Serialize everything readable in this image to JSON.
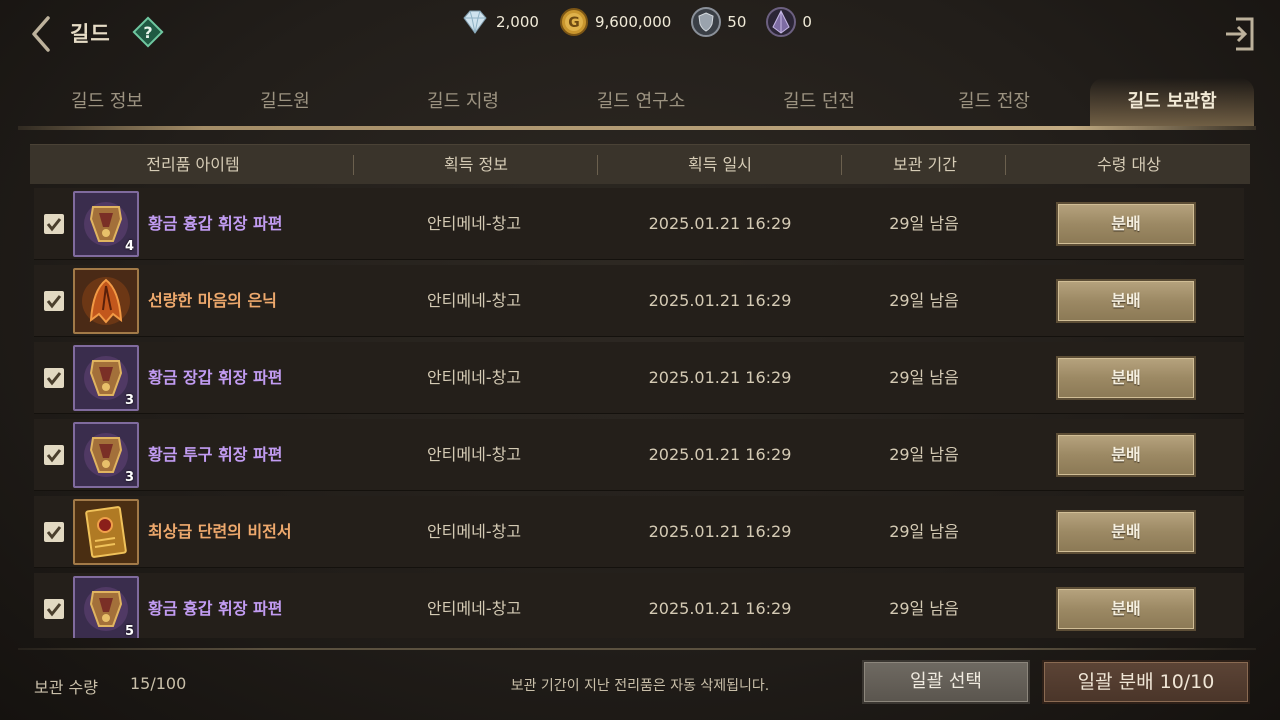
{
  "header": {
    "title": "길드",
    "currencies": [
      {
        "icon": "diamond-icon",
        "value": "2,000"
      },
      {
        "icon": "gold-coin-icon",
        "value": "9,600,000"
      },
      {
        "icon": "shield-token-icon",
        "value": "50"
      },
      {
        "icon": "crystal-icon",
        "value": "0"
      }
    ]
  },
  "tabs": [
    {
      "label": "길드 정보",
      "active": false
    },
    {
      "label": "길드원",
      "active": false
    },
    {
      "label": "길드 지령",
      "active": false
    },
    {
      "label": "길드 연구소",
      "active": false
    },
    {
      "label": "길드 던전",
      "active": false
    },
    {
      "label": "길드 전장",
      "active": false
    },
    {
      "label": "길드 보관함",
      "active": true
    }
  ],
  "table": {
    "columns": [
      "전리품 아이템",
      "획득 정보",
      "획득 일시",
      "보관 기간",
      "수령 대상"
    ],
    "rows": [
      {
        "checked": true,
        "item": "황금 흉갑 휘장 파편",
        "grade": "purple",
        "qty": "4",
        "source": "안티메네-창고",
        "date": "2025.01.21  16:29",
        "remaining": "29일 남음",
        "action": "분배"
      },
      {
        "checked": true,
        "item": "선량한 마음의 은닉",
        "grade": "orange",
        "qty": "",
        "source": "안티메네-창고",
        "date": "2025.01.21  16:29",
        "remaining": "29일 남음",
        "action": "분배"
      },
      {
        "checked": true,
        "item": "황금 장갑 휘장 파편",
        "grade": "purple",
        "qty": "3",
        "source": "안티메네-창고",
        "date": "2025.01.21  16:29",
        "remaining": "29일 남음",
        "action": "분배"
      },
      {
        "checked": true,
        "item": "황금 투구 휘장 파편",
        "grade": "purple",
        "qty": "3",
        "source": "안티메네-창고",
        "date": "2025.01.21  16:29",
        "remaining": "29일 남음",
        "action": "분배"
      },
      {
        "checked": true,
        "item": "최상급 단련의 비전서",
        "grade": "orange",
        "qty": "",
        "source": "안티메네-창고",
        "date": "2025.01.21  16:29",
        "remaining": "29일 남음",
        "action": "분배"
      },
      {
        "checked": true,
        "item": "황금 흉갑 휘장 파편",
        "grade": "purple",
        "qty": "5",
        "source": "안티메네-창고",
        "date": "2025.01.21  16:29",
        "remaining": "29일 남음",
        "action": "분배"
      }
    ]
  },
  "footer": {
    "storage_label": "보관 수량",
    "storage_count": "15/100",
    "notice": "보관 기간이 지난 전리품은 자동 삭제됩니다.",
    "bulk_select": "일괄 선택",
    "bulk_distribute": "일괄 분배 10/10"
  },
  "colors": {
    "grade_purple": "#c29cf2",
    "grade_orange": "#eea96d",
    "accent_gold": "#b6a37e"
  }
}
